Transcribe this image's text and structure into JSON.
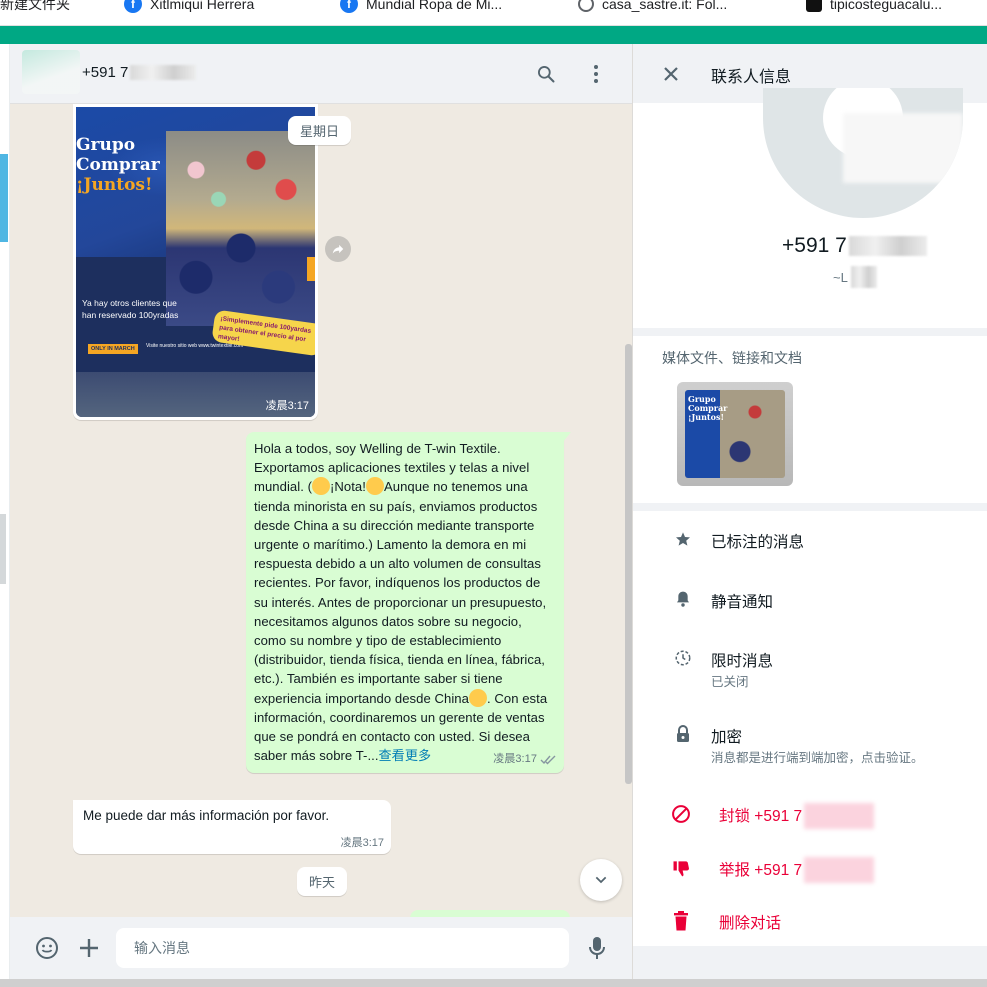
{
  "bookmarks": [
    {
      "label": "新建文件夹",
      "icon": "folder-icon"
    },
    {
      "label": "Xitlmiqui Herrera",
      "icon": "facebook-icon"
    },
    {
      "label": "Mundial Ropa de Mi...",
      "icon": "facebook-icon"
    },
    {
      "label": "casa_sastre.it: Fol...",
      "icon": "globe-icon"
    },
    {
      "label": "tipicosteguacalu...",
      "icon": "tiktok-icon"
    }
  ],
  "chat": {
    "phone": "+591 7",
    "date_sunday": "星期日",
    "date_yesterday": "昨天",
    "image_message": {
      "title_line1": "Grupo",
      "title_line2": "Comprar",
      "title_line3": "¡Juntos!",
      "tagline": "Ya hay otros clientes que han reservado 100yradas",
      "badge": "ONLY IN MARCH",
      "website": "Visite nuestro sitio web www.twintextile.com",
      "sticker": "¡Simplemente pide 100yardas para obtener el precio al por mayor!",
      "time": "凌晨3:17"
    },
    "outgoing": {
      "text_part1": "Hola a todos, soy Welling de T-win Textile. Exportamos aplicaciones textiles y telas a nivel mundial. (",
      "text_part2": "¡Nota!",
      "text_part3": "Aunque no tenemos una tienda minorista en su país, enviamos productos desde China a su dirección mediante transporte urgente o marítimo.)   Lamento la demora en mi respuesta debido a un alto volumen de consultas recientes. Por favor, indíquenos los productos de su interés. Antes de proporcionar un presupuesto, necesitamos algunos datos sobre su negocio, como su nombre y tipo de establecimiento (distribuidor, tienda física, tienda en línea, fábrica, etc.). También es importante saber si tiene experiencia importando desde China",
      "text_part4": ". Con esta información, coordinaremos un gerente de ventas que se pondrá en contacto con usted. Si desea saber más sobre T-...",
      "read_more": "查看更多",
      "time": "凌晨3:17"
    },
    "incoming": {
      "text": "Me puede dar más información por favor.",
      "time": "凌晨3:17"
    },
    "composer_placeholder": "输入消息"
  },
  "contact_info": {
    "title": "联系人信息",
    "phone": "+591 7",
    "subname": "~L",
    "media_label": "媒体文件、链接和文档",
    "media_thumb_text": "Grupo Comprar ¡Juntos!",
    "starred": "已标注的消息",
    "mute": "静音通知",
    "disappearing": "限时消息",
    "disappearing_status": "已关闭",
    "encryption": "加密",
    "encryption_desc": "消息都是进行端到端加密，点击验证。",
    "block": "封锁 +591 7",
    "report": "举报 +591 7",
    "delete": "删除对话"
  },
  "colors": {
    "accent": "#00a884",
    "outgoing_bubble": "#d9fdd3",
    "danger": "#ea0038",
    "link": "#027eb5"
  }
}
